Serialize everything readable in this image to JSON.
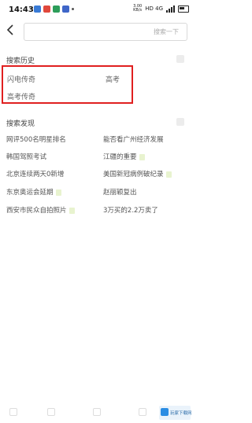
{
  "status_bar": {
    "time": "14:43",
    "speed_value": "3.00",
    "speed_unit": "KB/s",
    "network": "HD 4G"
  },
  "search": {
    "placeholder": "",
    "button_label": "搜索一下"
  },
  "history": {
    "title": "搜索历史",
    "items": [
      "闪电传奇",
      "高考",
      "高考传奇"
    ]
  },
  "discover": {
    "title": "搜索发现",
    "items": [
      {
        "label": "网评500名明星排名",
        "tag": false
      },
      {
        "label": "能否看广州经济发展",
        "tag": false
      },
      {
        "label": "韩国驾照考试",
        "tag": false
      },
      {
        "label": "江疆的重要",
        "tag": true
      },
      {
        "label": "北京连续两天0新增",
        "tag": false
      },
      {
        "label": "美国新冠病例破纪录",
        "tag": true
      },
      {
        "label": "东京奥运会延期",
        "tag": true
      },
      {
        "label": "赵丽颖复出",
        "tag": false
      },
      {
        "label": "西安市民众自拍照片",
        "tag": true
      },
      {
        "label": "3万买的2.2万卖了",
        "tag": false
      }
    ]
  },
  "watermark": {
    "text": "玩家下载网"
  },
  "colors": {
    "highlight_border": "#e02020",
    "tag_bg": "#e8f3cf"
  }
}
